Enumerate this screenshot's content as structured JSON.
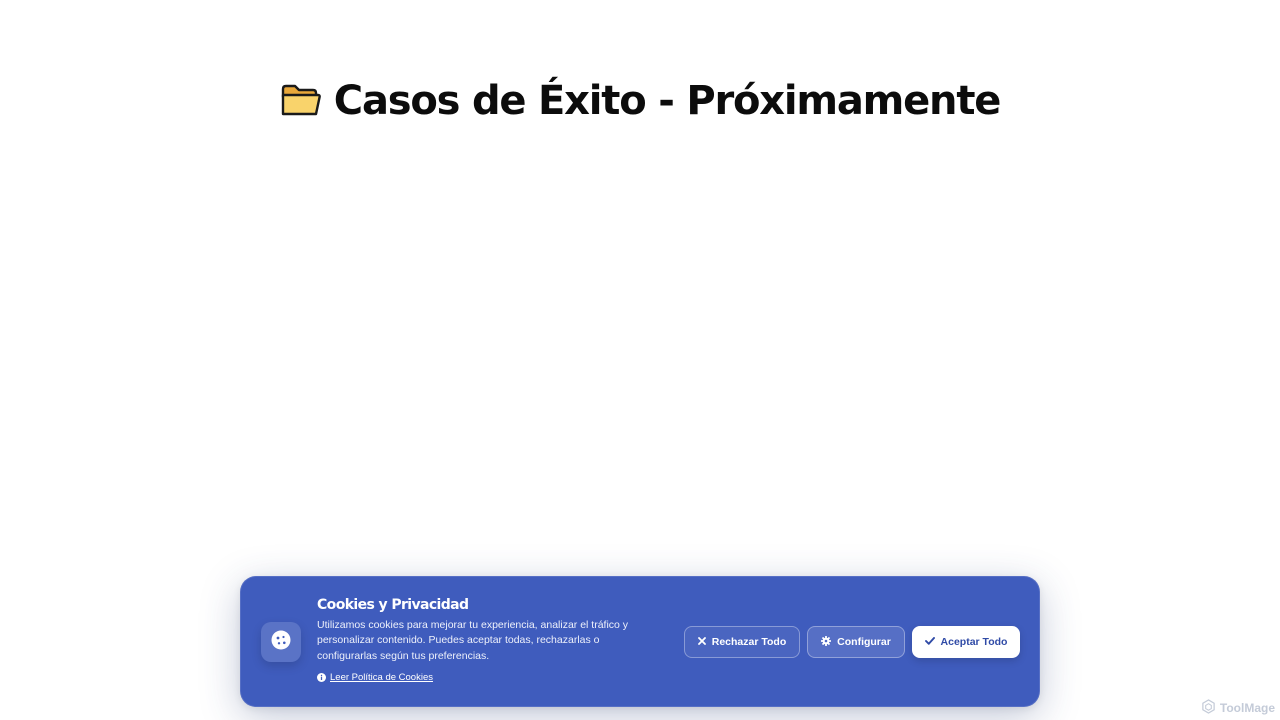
{
  "page": {
    "title": "Casos de Éxito - Próximamente",
    "title_icon": "folder-icon"
  },
  "cookie_banner": {
    "icon": "cookie-icon",
    "title": "Cookies y Privacidad",
    "description": "Utilizamos cookies para mejorar tu experiencia, analizar el tráfico y personalizar contenido. Puedes aceptar todas, rechazarlas o configurarlas según tus preferencias.",
    "policy_link": "Leer Política de Cookies",
    "policy_icon": "info-icon",
    "reject_label": "Rechazar Todo",
    "reject_icon": "close-icon",
    "config_label": "Configurar",
    "config_icon": "gear-icon",
    "accept_label": "Aceptar Todo",
    "accept_icon": "check-icon",
    "colors": {
      "banner_bg": "#3f5cbd",
      "accept_text": "#2f4aa6"
    }
  },
  "watermark": {
    "text": "ToolMage",
    "icon": "toolmage-logo-icon"
  }
}
